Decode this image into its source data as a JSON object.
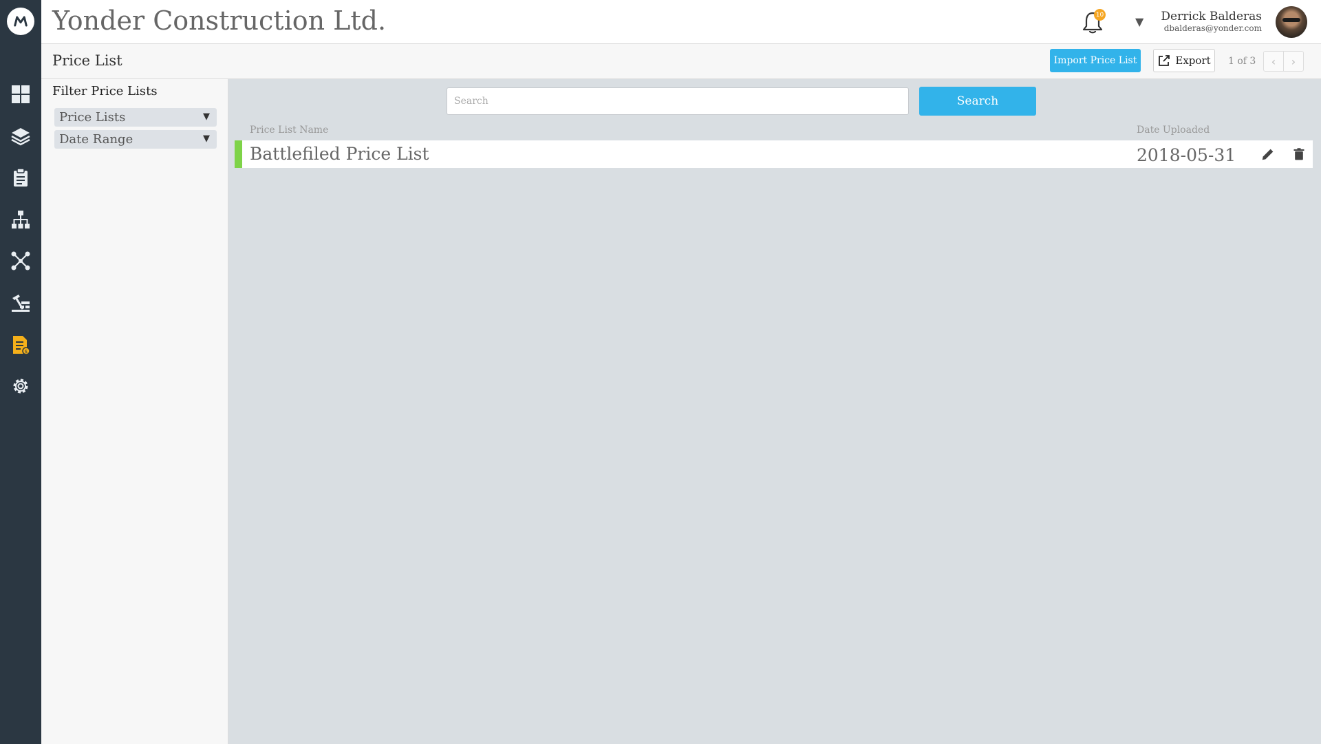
{
  "app": {
    "company": "Yonder Construction Ltd.",
    "notifications_count": "10",
    "user": {
      "name": "Derrick Balderas",
      "email": "dbalderas@yonder.com"
    }
  },
  "nav": {
    "items": [
      {
        "icon": "dashboard-icon",
        "active": false
      },
      {
        "icon": "layers-icon",
        "active": false
      },
      {
        "icon": "clipboard-icon",
        "active": false
      },
      {
        "icon": "org-chart-icon",
        "active": false
      },
      {
        "icon": "network-icon",
        "active": false
      },
      {
        "icon": "construction-icon",
        "active": false
      },
      {
        "icon": "price-list-document-icon",
        "active": true
      },
      {
        "icon": "settings-gear-icon",
        "active": false
      }
    ],
    "active_color": "#f5b01a",
    "icon_color": "#e9eef2"
  },
  "subheader": {
    "title": "Price List",
    "import_label": "Import Price List",
    "export_label": "Export",
    "pager": "1 of 3",
    "prev_label": "‹",
    "next_label": "›"
  },
  "filter": {
    "title": "Filter Price Lists",
    "dropdowns": [
      "Price Lists",
      "Date Range"
    ]
  },
  "search": {
    "placeholder": "Search",
    "value": "",
    "button_label": "Search"
  },
  "table": {
    "columns": [
      "Price List Name",
      "Date Uploaded"
    ],
    "rows": [
      {
        "name": "Battlefiled Price List",
        "date": "2018-05-31",
        "status_color": "#7ed348"
      }
    ]
  },
  "colors": {
    "accent": "#32b3ea",
    "rail": "#2b3742",
    "badge": "#f5a623",
    "main_bg": "#d9dee2"
  }
}
